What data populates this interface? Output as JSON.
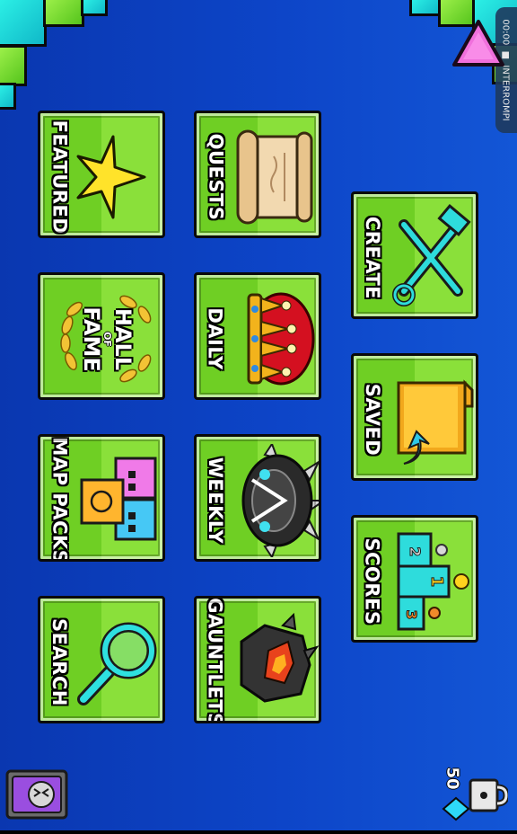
{
  "status_bar": {
    "time": "00:00",
    "recording_label": "INTERROMPI"
  },
  "buttons": {
    "featured": "FEATURED",
    "hall_of_fame": [
      "HALL",
      "OF",
      "FAME"
    ],
    "map_packs": "MAP PACKS",
    "search": "SEARCH",
    "quests": "QUESTS",
    "daily": "DAILY",
    "weekly": "WEEKLY",
    "gauntlets": "GAUNTLETS",
    "create": "CREATE",
    "saved": "SAVED",
    "scores": "SCORES"
  },
  "scores_places": [
    "1",
    "2",
    "3"
  ],
  "diamonds": "50",
  "icons": [
    "back-arrow-icon",
    "star-icon",
    "laurel-icon",
    "map-pack-icon",
    "magnifier-icon",
    "scroll-icon",
    "crown-icon",
    "spiked-helmet-icon",
    "gauntlet-icon",
    "wrench-hammer-icon",
    "folder-icon",
    "podium-icon",
    "diamond-icon",
    "lock-icon",
    "vault-icon"
  ],
  "colors": {
    "background": "#0d45c8",
    "button_green": "#8ae03a",
    "button_dark_green": "#6fcf24",
    "cyan_block": "#2cf0e6",
    "pink_arrow": "#f06ad8"
  }
}
